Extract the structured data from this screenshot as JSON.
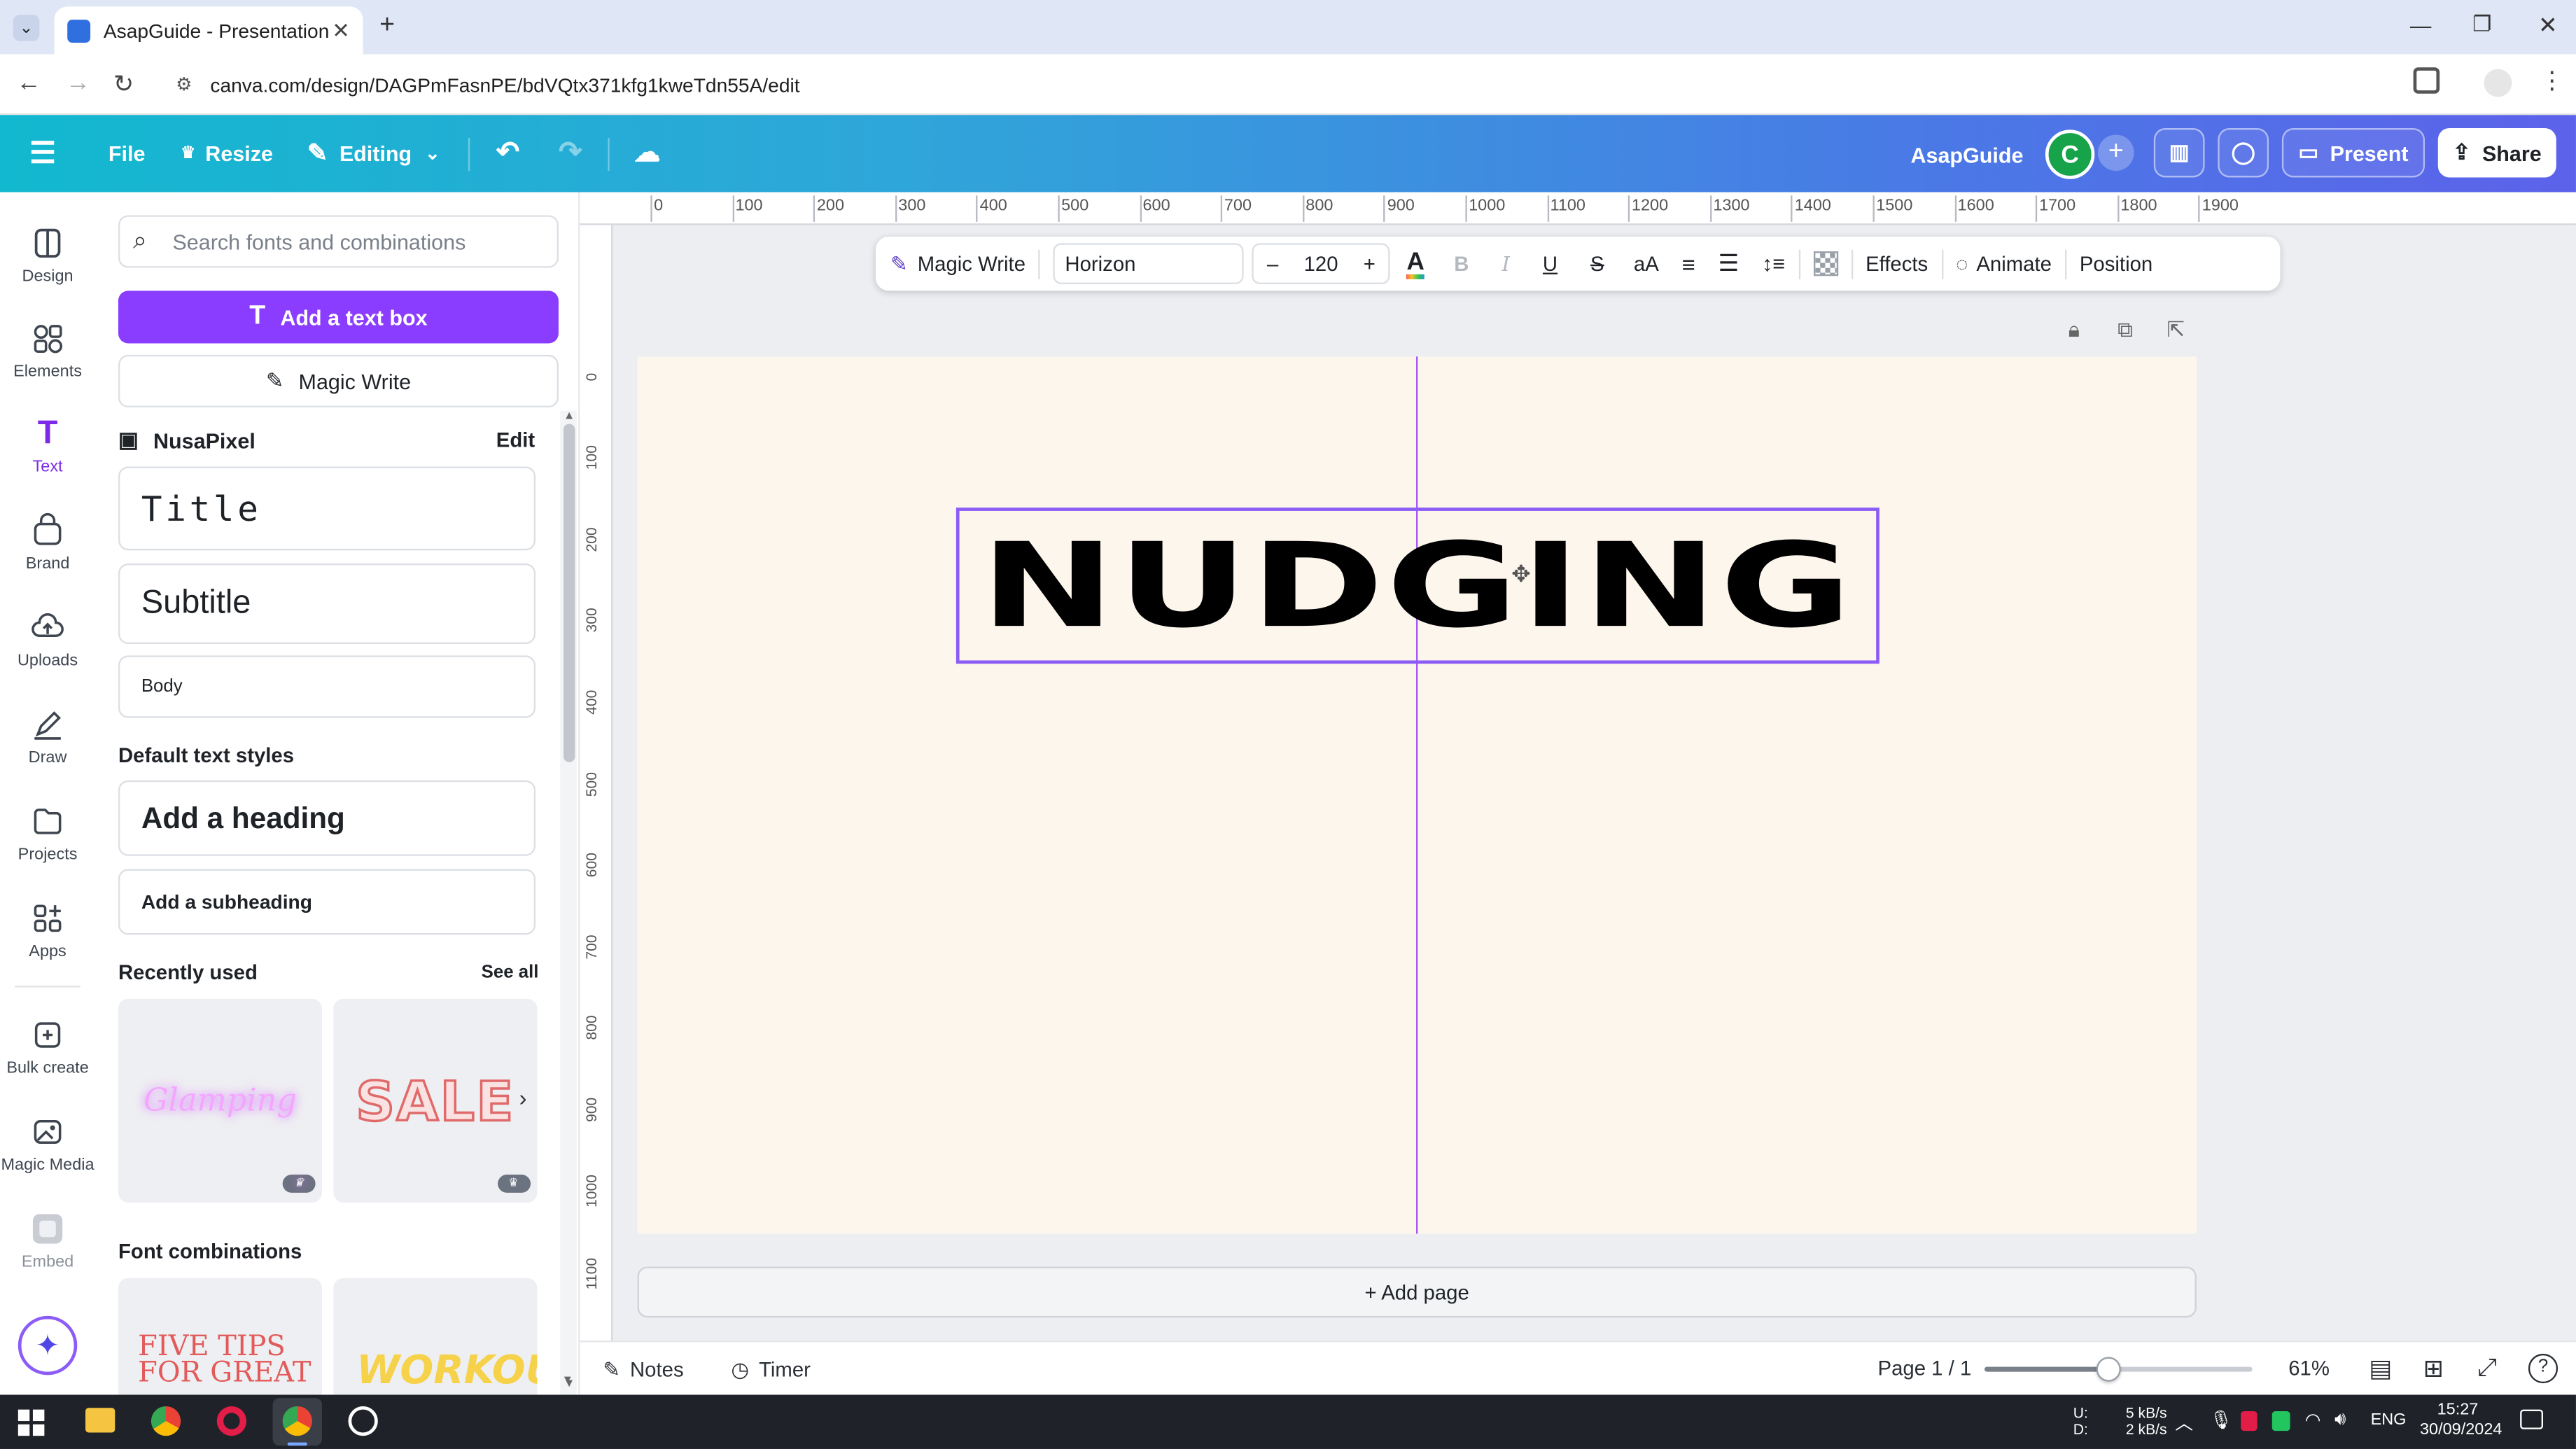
{
  "browser": {
    "tab_title": "AsapGuide - Presentation",
    "url": "canva.com/design/DAGPmFasnPE/bdVQtx371kfg1kweTdn55A/edit"
  },
  "header": {
    "file": "File",
    "resize": "Resize",
    "editing": "Editing",
    "team_name": "AsapGuide",
    "avatar_letter": "C",
    "present": "Present",
    "share": "Share"
  },
  "rail": {
    "items": [
      {
        "label": "Design",
        "icon": "design-icon"
      },
      {
        "label": "Elements",
        "icon": "elements-icon"
      },
      {
        "label": "Text",
        "icon": "text-icon"
      },
      {
        "label": "Brand",
        "icon": "brand-icon"
      },
      {
        "label": "Uploads",
        "icon": "uploads-icon"
      },
      {
        "label": "Draw",
        "icon": "draw-icon"
      },
      {
        "label": "Projects",
        "icon": "projects-icon"
      },
      {
        "label": "Apps",
        "icon": "apps-icon"
      },
      {
        "label": "Bulk create",
        "icon": "bulk-create-icon"
      },
      {
        "label": "Magic Media",
        "icon": "magic-media-icon"
      },
      {
        "label": "Embed",
        "icon": "embed-icon"
      }
    ]
  },
  "panel": {
    "search_placeholder": "Search fonts and combinations",
    "add_text_box": "Add a text box",
    "magic_write": "Magic Write",
    "brand_kit": "NusaPixel",
    "brand_edit": "Edit",
    "brand_title": "Title",
    "brand_subtitle": "Subtitle",
    "brand_body": "Body",
    "default_styles_heading": "Default text styles",
    "add_heading": "Add a heading",
    "add_subheading": "Add a subheading",
    "recently_used": "Recently used",
    "see_all": "See all",
    "recent_1": "Glamping",
    "recent_2": "SALE",
    "font_combinations": "Font combinations",
    "combo_1": "FIVE TIPS FOR GREAT",
    "combo_2": "WORKOUT"
  },
  "toolbar": {
    "magic_write": "Magic Write",
    "font": "Horizon",
    "size": "120",
    "effects": "Effects",
    "animate": "Animate",
    "position": "Position"
  },
  "ruler": {
    "top": [
      "0",
      "100",
      "200",
      "300",
      "400",
      "500",
      "600",
      "700",
      "800",
      "900",
      "1000",
      "1100",
      "1200",
      "1300",
      "1400",
      "1500",
      "1600",
      "1700",
      "1800",
      "1900"
    ],
    "left": [
      "0",
      "100",
      "200",
      "300",
      "400",
      "500",
      "600",
      "700",
      "800",
      "900",
      "1000",
      "1100"
    ]
  },
  "canvas": {
    "headline": "NUDGING",
    "add_page": "+ Add page"
  },
  "footer": {
    "notes": "Notes",
    "timer": "Timer",
    "page_indicator": "Page 1 / 1",
    "zoom": "61%",
    "zoom_fraction": 0.46
  },
  "taskbar": {
    "net_up_label": "U:",
    "net_down_label": "D:",
    "net_up": "5 kB/s",
    "net_down": "2 kB/s",
    "language": "ENG",
    "time": "15:27",
    "date": "30/09/2024"
  },
  "colors": {
    "purple": "#7d2ae8",
    "page_bg": "#fdf6ec",
    "guide": "#a855f7"
  }
}
